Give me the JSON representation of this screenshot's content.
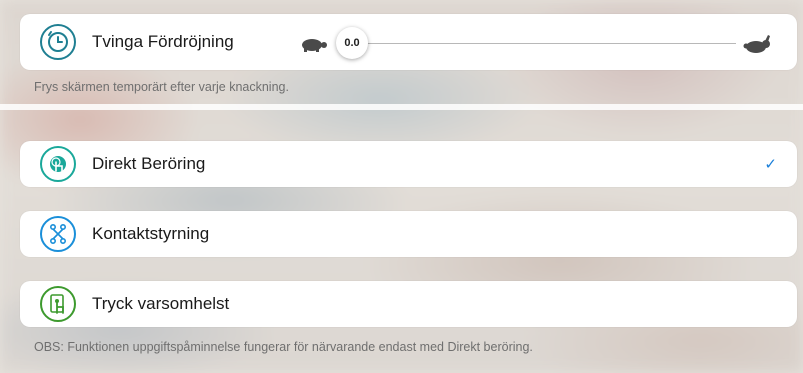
{
  "force_delay": {
    "title": "Tvinga Fördröjning",
    "slider_value_label": "0.0",
    "slider_fraction": 0.0,
    "slow_icon": "turtle-icon",
    "fast_icon": "rabbit-icon",
    "description": "Frys skärmen temporärt efter varje knackning."
  },
  "modes": [
    {
      "label": "Direkt Beröring",
      "icon": "touch-icon",
      "color": "#1aa89a",
      "selected": true
    },
    {
      "label": "Kontaktstyrning",
      "icon": "switch-control-icon",
      "color": "#1a8fd9",
      "selected": false
    },
    {
      "label": "Tryck varsomhelst",
      "icon": "tap-anywhere-icon",
      "color": "#3d9a2e",
      "selected": false
    }
  ],
  "checkmark": "✓",
  "footer_note": "OBS: Funktionen uppgiftspåminnelse fungerar för närvarande endast med Direkt beröring."
}
